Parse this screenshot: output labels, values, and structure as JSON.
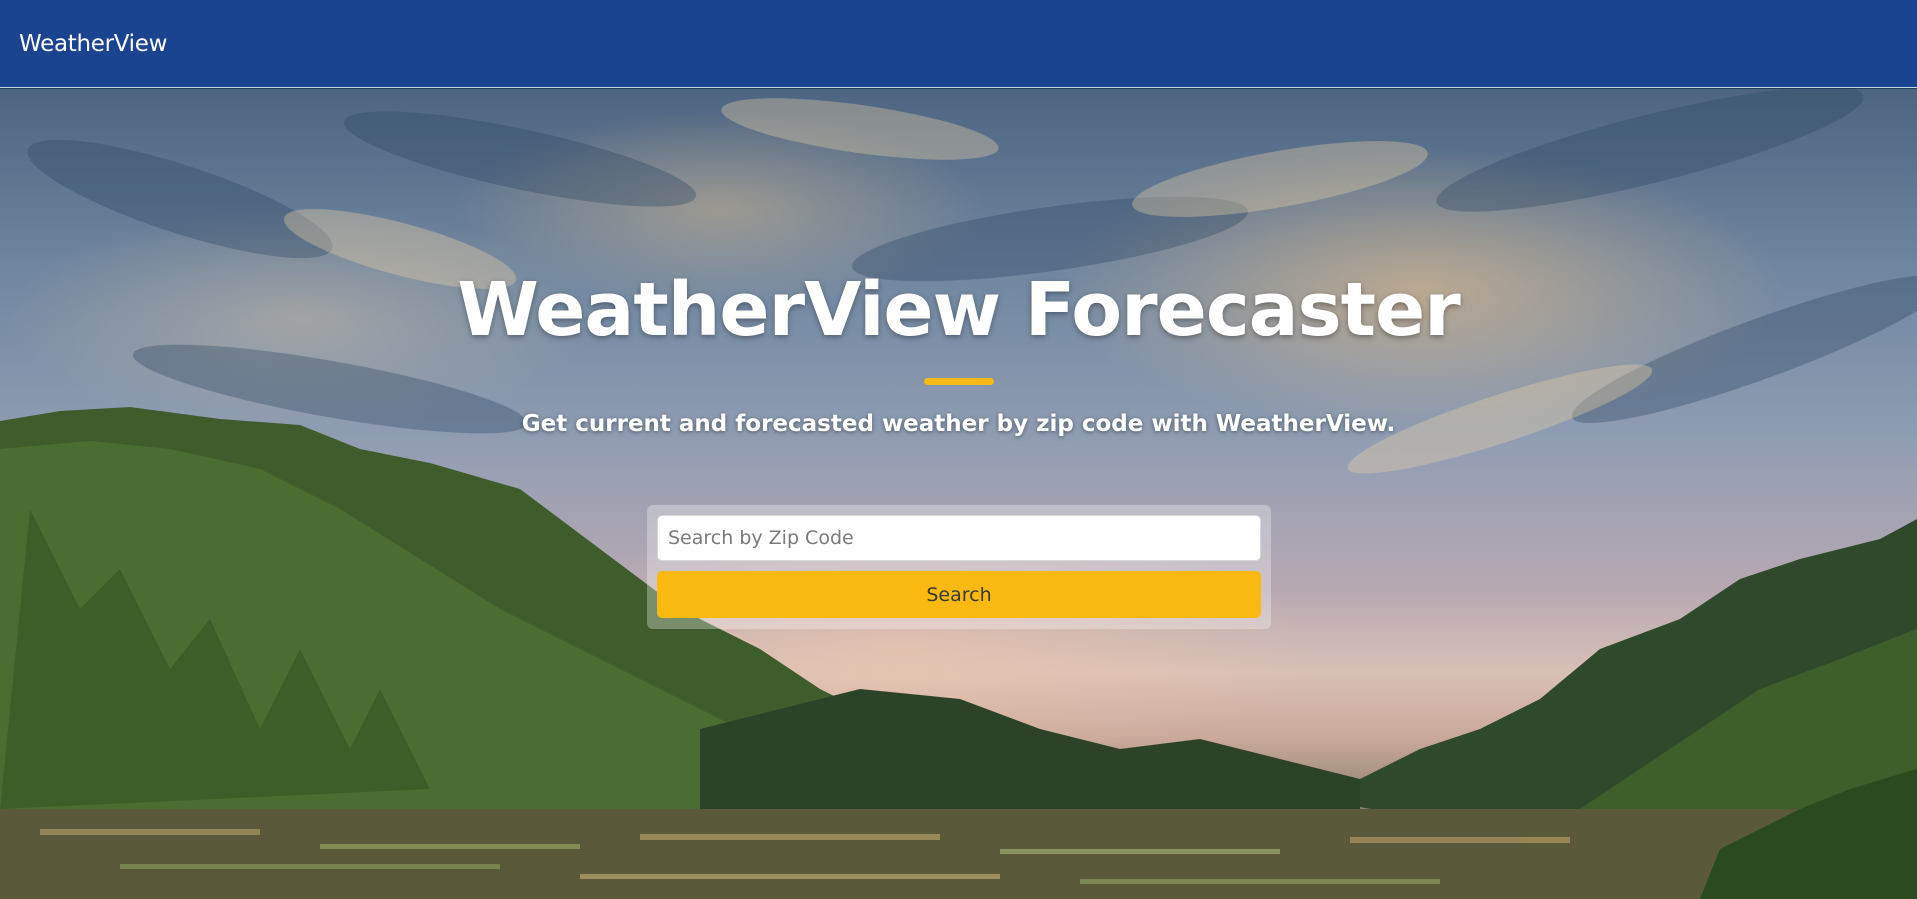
{
  "navbar": {
    "brand": "WeatherView"
  },
  "hero": {
    "title": "WeatherView Forecaster",
    "subtitle": "Get current and forecasted weather by zip code with WeatherView.",
    "search": {
      "placeholder": "Search by Zip Code",
      "value": "",
      "button_label": "Search"
    }
  },
  "colors": {
    "navbar": "#1b4490",
    "accent": "#f9b911",
    "title_underline": "#f6b917"
  }
}
